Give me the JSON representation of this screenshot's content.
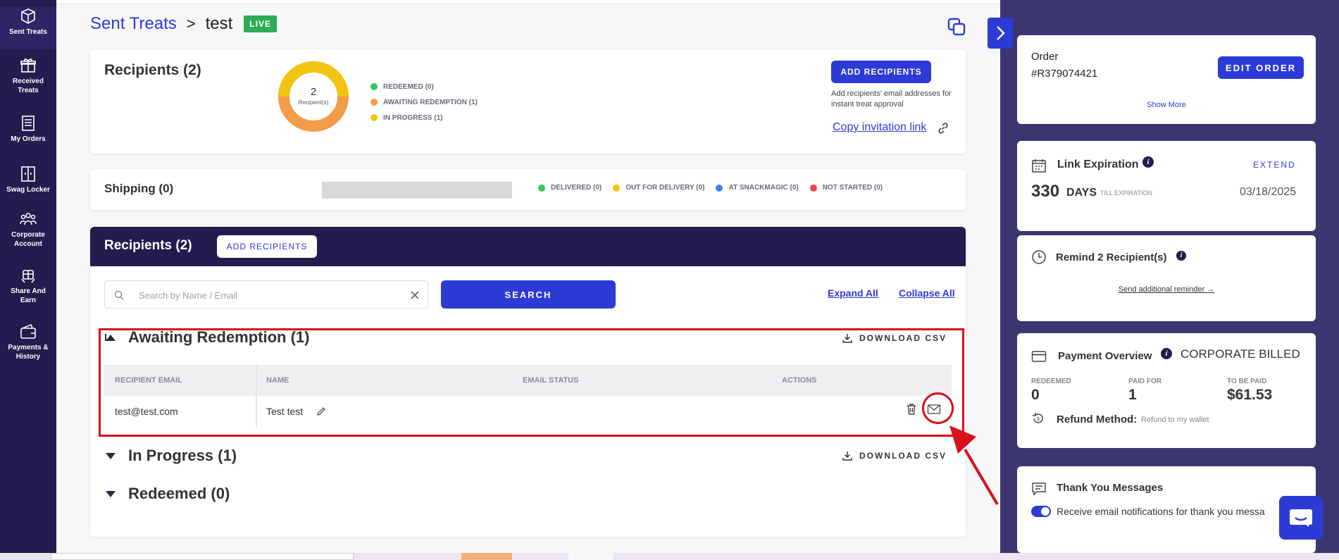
{
  "nav": {
    "items": [
      {
        "label": "Sent Treats",
        "icon": "box-icon"
      },
      {
        "label": "Received Treats",
        "icon": "gift-icon"
      },
      {
        "label": "My Orders",
        "icon": "receipt-icon"
      },
      {
        "label": "Swag Locker",
        "icon": "locker-icon"
      },
      {
        "label": "Corporate Account",
        "icon": "team-icon"
      },
      {
        "label": "Share And Earn",
        "icon": "share-gift-icon"
      },
      {
        "label": "Payments & History",
        "icon": "wallet-icon"
      }
    ]
  },
  "breadcrumb": {
    "parent": "Sent Treats",
    "separator": ">",
    "current": "test",
    "badge": "LIVE"
  },
  "summary": {
    "title": "Recipients (2)",
    "donut_count": "2",
    "donut_caption": "Recipient(s)",
    "legend": [
      {
        "label": "REDEEMED (0)",
        "color": "#34c759"
      },
      {
        "label": "AWAITING REDEMPTION (1)",
        "color": "#f29b49"
      },
      {
        "label": "IN PROGRESS (1)",
        "color": "#f2c40f"
      }
    ],
    "add_button": "ADD RECIPIENTS",
    "add_help": "Add recipients' email addresses for instant treat approval",
    "copy_link": "Copy invitation link"
  },
  "shipping": {
    "title": "Shipping (0)",
    "legend": [
      {
        "label": "DELIVERED (0)",
        "color": "#34c759"
      },
      {
        "label": "OUT FOR DELIVERY (0)",
        "color": "#f2c40f"
      },
      {
        "label": "AT SNACKMAGIC (0)",
        "color": "#3b82f6"
      },
      {
        "label": "NOT STARTED (0)",
        "color": "#ef4444"
      }
    ]
  },
  "recipients": {
    "title": "Recipients (2)",
    "add_button": "ADD RECIPIENTS",
    "search_placeholder": "Search by Name / Email",
    "search_button": "SEARCH",
    "expand_all": "Expand All",
    "collapse_all": "Collapse All",
    "download_csv": "DOWNLOAD CSV",
    "groups": [
      {
        "title": "Awaiting Redemption (1)",
        "expanded": true
      },
      {
        "title": "In Progress (1)",
        "expanded": false
      },
      {
        "title": "Redeemed (0)",
        "expanded": false
      }
    ],
    "columns": [
      "RECIPIENT EMAIL",
      "NAME",
      "EMAIL STATUS",
      "ACTIONS"
    ],
    "rows": [
      {
        "email": "test@test.com",
        "name": "Test test",
        "status": ""
      }
    ]
  },
  "order": {
    "label": "Order",
    "number": "#R379074421",
    "edit_button": "EDIT ORDER",
    "show_more": "Show More"
  },
  "link_expiration": {
    "title": "Link Expiration",
    "extend": "EXTEND",
    "days": "330",
    "days_unit": "DAYS",
    "till": "TILL EXPIRATION",
    "date": "03/18/2025"
  },
  "remind": {
    "title": "Remind 2 Recipient(s)",
    "link": "Send additional reminder →"
  },
  "payment": {
    "title": "Payment Overview",
    "billing": "CORPORATE BILLED",
    "stats": [
      {
        "label": "REDEEMED",
        "value": "0"
      },
      {
        "label": "PAID FOR",
        "value": "1"
      },
      {
        "label": "TO BE PAID",
        "value": "$61.53"
      }
    ],
    "refund_label": "Refund Method:",
    "refund_value": "Refund to my wallet"
  },
  "thanks": {
    "title": "Thank You Messages",
    "toggle_label": "Receive email notifications for thank you messa"
  },
  "colors": {
    "accent": "#2d3bd6",
    "nav": "#231c4f",
    "highlight": "#d6101c"
  }
}
